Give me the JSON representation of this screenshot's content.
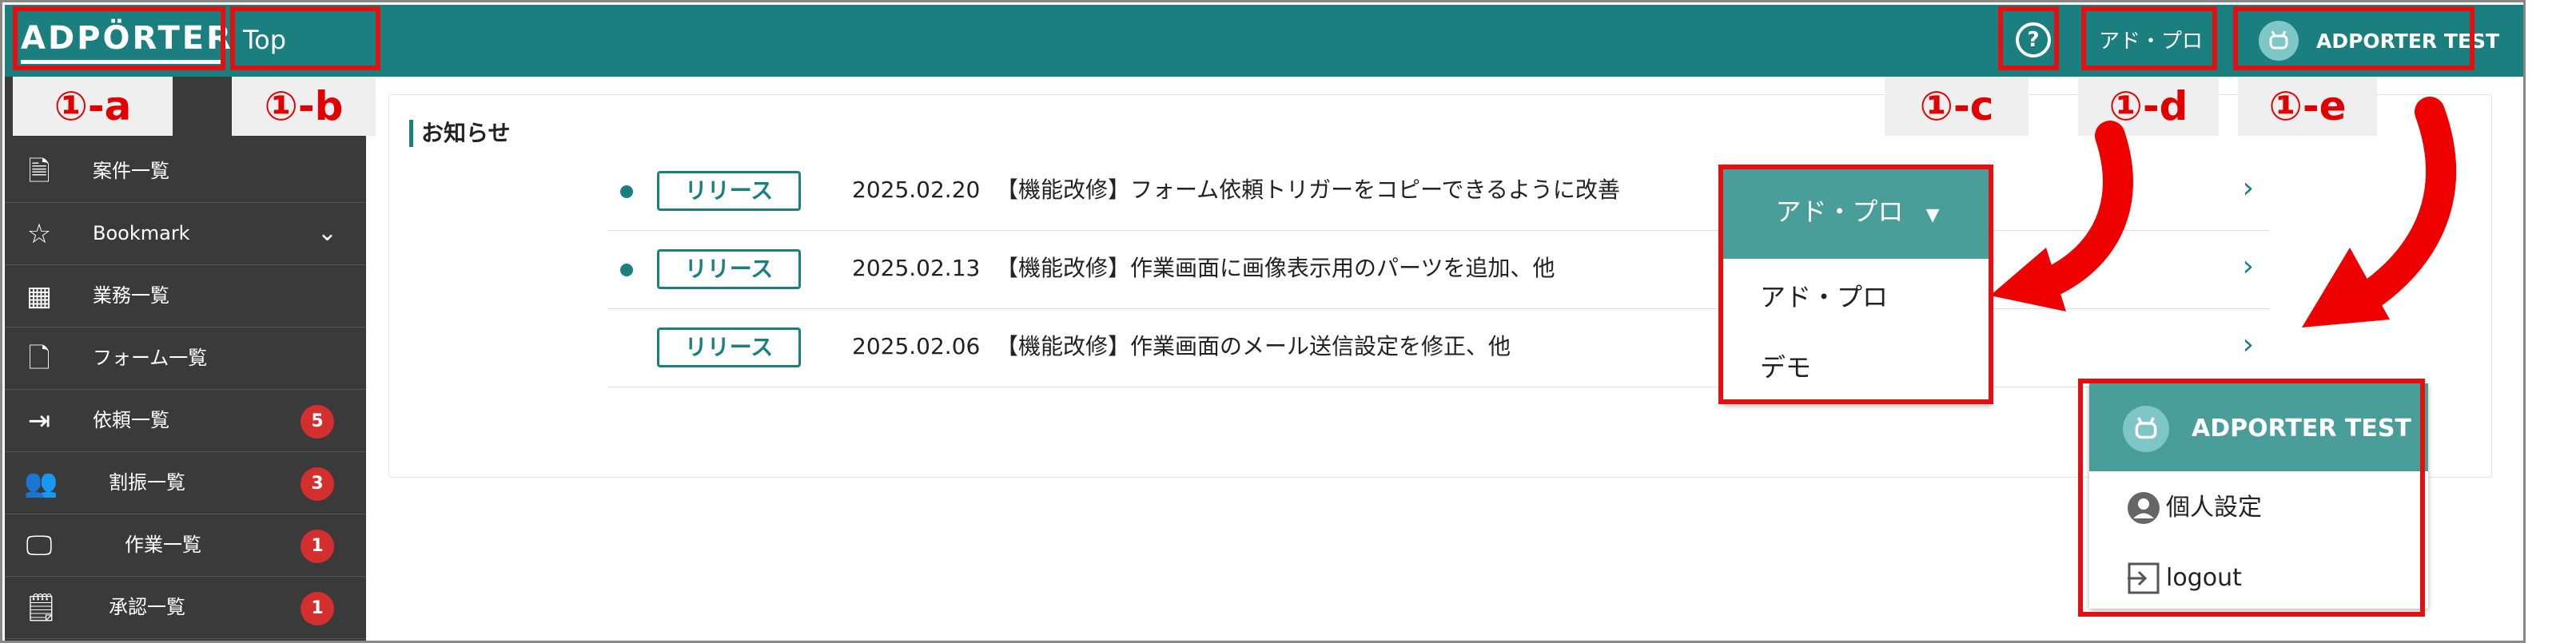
{
  "header": {
    "logo_text": "ADPÖRTER",
    "page_title": "Top",
    "help_icon": "question-circle-icon",
    "org_label": "アド・プロ",
    "user_label": "ADPORTER TEST"
  },
  "annotations": {
    "a": "①-a",
    "b": "①-b",
    "c": "①-c",
    "d": "①-d",
    "e": "①-e"
  },
  "sidebar": {
    "items": [
      {
        "label": "案件一覧",
        "icon": "document-icon"
      },
      {
        "label": "Bookmark",
        "icon": "star-icon"
      },
      {
        "label": "業務一覧",
        "icon": "building-icon"
      },
      {
        "label": "フォーム一覧",
        "icon": "form-icon"
      },
      {
        "label": "依頼一覧",
        "icon": "inbox-icon",
        "badge": "5"
      },
      {
        "label": "割振一覧",
        "icon": "people-icon",
        "badge": "3"
      },
      {
        "label": "作業一覧",
        "icon": "monitor-icon",
        "badge": "1"
      },
      {
        "label": "承認一覧",
        "icon": "approval-icon",
        "badge": "1"
      }
    ]
  },
  "notices": {
    "title": "お知らせ",
    "items": [
      {
        "tag": "リリース",
        "date": "2025.02.20",
        "text": "【機能改修】フォーム依頼トリガーをコピーできるように改善",
        "unread": true
      },
      {
        "tag": "リリース",
        "date": "2025.02.13",
        "text": "【機能改修】作業画面に画像表示用のパーツを追加、他",
        "unread": true
      },
      {
        "tag": "リリース",
        "date": "2025.02.06",
        "text": "【機能改修】作業画面のメール送信設定を修正、他",
        "unread": false
      }
    ]
  },
  "org_menu": {
    "selected": "アド・プロ",
    "options": [
      "アド・プロ",
      "デモ"
    ]
  },
  "user_menu": {
    "name": "ADPORTER TEST",
    "items": [
      {
        "label": "個人設定",
        "icon": "account-circle-icon"
      },
      {
        "label": "logout",
        "icon": "logout-icon"
      }
    ]
  },
  "colors": {
    "header_bg": "#1b7f7f",
    "sidebar_bg": "#3a3a3a",
    "accent": "#1b7f7f",
    "dropdown_head": "#4a9e9a",
    "badge": "#d32f2f",
    "annotation": "#e11111"
  }
}
